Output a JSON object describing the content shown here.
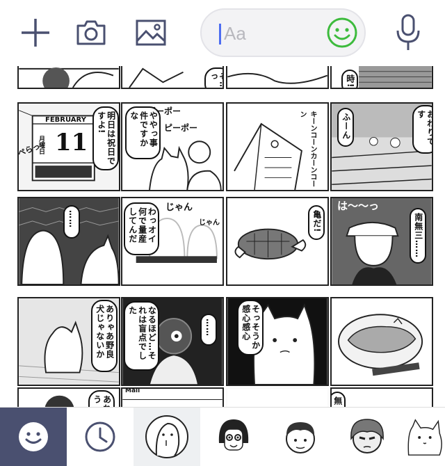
{
  "toolbar": {
    "add_icon": "plus-icon",
    "camera_icon": "camera-icon",
    "image_icon": "image-icon",
    "input_placeholder": "Aa",
    "emoji_icon": "smiley-icon",
    "mic_icon": "microphone-icon"
  },
  "colors": {
    "accent_green": "#3dbb3d",
    "icon_navy": "#4a5070",
    "caret_blue": "#4d6df1"
  },
  "stickers": [
    {
      "id": "r0c0",
      "texts": []
    },
    {
      "id": "r0c1",
      "texts": [
        "そ…っ"
      ]
    },
    {
      "id": "r0c2",
      "texts": []
    },
    {
      "id": "r0c3",
      "texts": [
        "時!!"
      ]
    },
    {
      "id": "r1c0",
      "texts": [
        "明日は祝日ですよ!",
        "FEBRUARY",
        "11",
        "月曜日",
        "ぺらっ"
      ]
    },
    {
      "id": "r1c1",
      "texts": [
        "ややっ事件ですかな",
        "ピーポー",
        "ピーポー"
      ]
    },
    {
      "id": "r1c2",
      "texts": [
        "キーンコーンカーンコーン"
      ]
    },
    {
      "id": "r1c3",
      "texts": [
        "ふーん",
        "おわりです"
      ]
    },
    {
      "id": "r2c0",
      "texts": [
        "……",
        "……"
      ]
    },
    {
      "id": "r2c1",
      "texts": [
        "わっオイ何で量産してんだ",
        "じゃん",
        "じゃん"
      ]
    },
    {
      "id": "r2c2",
      "texts": [
        "亀だ!"
      ]
    },
    {
      "id": "r2c3",
      "texts": [
        "は〜〜っ",
        "南無三……"
      ]
    },
    {
      "id": "r3c0",
      "texts": [
        "ありゃあ野良犬じゃないか"
      ]
    },
    {
      "id": "r3c1",
      "texts": [
        "なるほど…それは盲点でした",
        "……"
      ]
    },
    {
      "id": "r3c2",
      "texts": [
        "そっそうか感心感心"
      ]
    },
    {
      "id": "r3c3",
      "texts": []
    },
    {
      "id": "r4c0",
      "texts": [
        "あれ使う"
      ]
    },
    {
      "id": "r4c1",
      "texts": [
        "Mail"
      ]
    },
    {
      "id": "r4c2",
      "texts": []
    },
    {
      "id": "r4c3",
      "texts": [
        "無"
      ]
    }
  ],
  "bottom_tabs": [
    {
      "name": "emoji-tab",
      "icon": "smiley-icon"
    },
    {
      "name": "recent-tab",
      "icon": "clock-icon"
    },
    {
      "name": "sticker-pack-1",
      "icon": "ghost-character-icon"
    },
    {
      "name": "sticker-pack-2",
      "icon": "girl-character-icon"
    },
    {
      "name": "sticker-pack-3",
      "icon": "boy-character-icon"
    },
    {
      "name": "sticker-pack-4",
      "icon": "helmet-character-icon"
    },
    {
      "name": "sticker-pack-5",
      "icon": "cat-character-icon"
    }
  ]
}
